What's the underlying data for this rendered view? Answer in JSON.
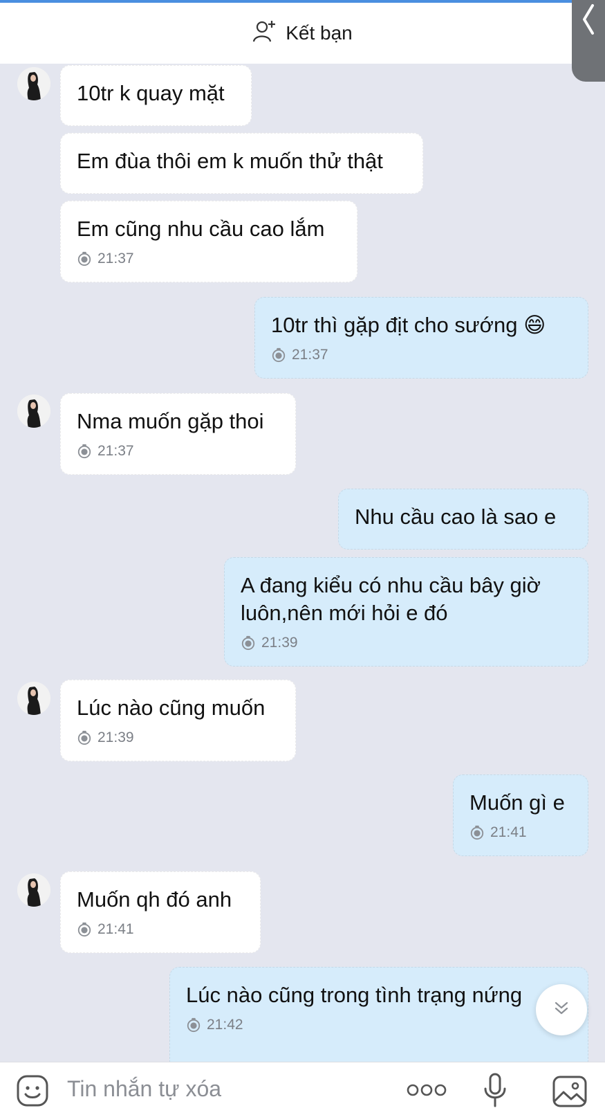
{
  "header": {
    "add_friend_label": "Kết bạn"
  },
  "messages": [
    {
      "text": "10tr k quay mặt",
      "time": ""
    },
    {
      "text": "Em đùa thôi em k muốn thử thật",
      "time": ""
    },
    {
      "text": "Em cũng nhu cầu cao lắm",
      "time": "21:37"
    },
    {
      "text": "10tr thì gặp địt cho sướng 😄",
      "time": "21:37"
    },
    {
      "text": "Nma muốn gặp thoi",
      "time": "21:37"
    },
    {
      "text": "Nhu cầu cao là sao e",
      "time": ""
    },
    {
      "text": "A đang kiểu có nhu cầu bây giờ luôn,nên mới hỏi e đó",
      "time": "21:39"
    },
    {
      "text": "Lúc nào cũng muốn",
      "time": "21:39"
    },
    {
      "text": "Muốn gì e",
      "time": "21:41"
    },
    {
      "text": "Muốn qh đó anh",
      "time": "21:41"
    },
    {
      "text": "Lúc nào cũng trong tình trạng nứng",
      "time": "21:42"
    }
  ],
  "composer": {
    "placeholder": "Tin nhắn tự xóa"
  },
  "icons": {
    "add_friend": "add-user-icon",
    "back": "chevron-left-icon",
    "timer": "timer-icon",
    "scroll_down": "double-chevron-down-icon",
    "sticker": "sticker-icon",
    "more": "more-icon",
    "mic": "microphone-icon",
    "image": "image-icon"
  },
  "colors": {
    "background": "#e4e6ef",
    "incoming_bubble": "#ffffff",
    "outgoing_bubble": "#d6ecfb",
    "accent": "#4a8fe0"
  }
}
